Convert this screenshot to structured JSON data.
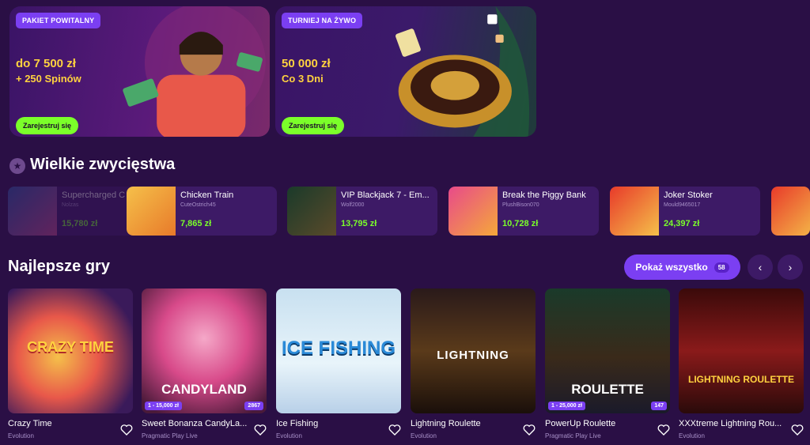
{
  "promos": [
    {
      "badge": "PAKIET POWITALNY",
      "amount": "do 7 500 zł",
      "sub": "+ 250 Spinów",
      "cta": "Zarejestruj się"
    },
    {
      "badge": "TURNIEJ NA ŻYWO",
      "amount": "50 000 zł",
      "sub": "Co 3 Dni",
      "cta": "Zarejestruj się"
    }
  ],
  "wins": {
    "title": "Wielkie zwycięstwa",
    "items": [
      {
        "game": "Supercharged C",
        "user": "Nolzas",
        "value": "15,780 zł"
      },
      {
        "game": "Chicken Train",
        "user": "CuteOstrich45",
        "value": "7,865 zł"
      },
      {
        "game": "VIP Blackjack 7 - Em...",
        "user": "Wolf2000",
        "value": "13,795 zł"
      },
      {
        "game": "Break the Piggy Bank",
        "user": "PlushBison070",
        "value": "10,728 zł"
      },
      {
        "game": "Joker Stoker",
        "user": "Mould9465017",
        "value": "24,397 zł"
      }
    ]
  },
  "top_games": {
    "title": "Najlepsze gry",
    "show_all_label": "Pokaż wszystko",
    "show_all_count": "58",
    "items": [
      {
        "name": "Crazy Time",
        "provider": "Evolution",
        "art": "CRAZY TIME"
      },
      {
        "name": "Sweet Bonanza CandyLa...",
        "provider": "Pragmatic Play Live",
        "art": "CANDYLAND",
        "range": "1 - 15,000 zł",
        "players": "2867"
      },
      {
        "name": "Ice Fishing",
        "provider": "Evolution",
        "art": "ICE FISHING"
      },
      {
        "name": "Lightning Roulette",
        "provider": "Evolution",
        "art": "LIGHTNING"
      },
      {
        "name": "PowerUp Roulette",
        "provider": "Pragmatic Play Live",
        "art": "ROULETTE",
        "range": "1 - 25,000 zł",
        "players": "147"
      },
      {
        "name": "XXXtreme Lightning Rou...",
        "provider": "Evolution",
        "art": "LIGHTNING ROULETTE"
      }
    ]
  },
  "colors": {
    "bg": "#2a0f45",
    "card": "#3d1a66",
    "accent": "#7b3ff2",
    "green": "#7bff2a",
    "gold": "#ffd23f"
  }
}
